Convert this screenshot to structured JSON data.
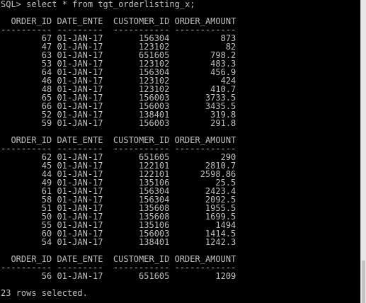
{
  "prompt": "SQL> select * from tgt_orderlisting_x;",
  "headers": [
    "ORDER_ID",
    "DATE_ENTE",
    "CUSTOMER_ID",
    "ORDER_AMOUNT"
  ],
  "separators": [
    "----------",
    "---------",
    "-----------",
    "------------"
  ],
  "pages": [
    {
      "rows": [
        [
          "67",
          "01-JAN-17",
          "156304",
          "873"
        ],
        [
          "47",
          "01-JAN-17",
          "123102",
          "82"
        ],
        [
          "63",
          "01-JAN-17",
          "651605",
          "798.2"
        ],
        [
          "53",
          "01-JAN-17",
          "123102",
          "483.3"
        ],
        [
          "64",
          "01-JAN-17",
          "156304",
          "456.9"
        ],
        [
          "46",
          "01-JAN-17",
          "123102",
          "424"
        ],
        [
          "48",
          "01-JAN-17",
          "123102",
          "410.7"
        ],
        [
          "65",
          "01-JAN-17",
          "156003",
          "3733.5"
        ],
        [
          "66",
          "01-JAN-17",
          "156003",
          "3435.5"
        ],
        [
          "52",
          "01-JAN-17",
          "138401",
          "319.8"
        ],
        [
          "59",
          "01-JAN-17",
          "156003",
          "291.8"
        ]
      ]
    },
    {
      "rows": [
        [
          "62",
          "01-JAN-17",
          "651605",
          "290"
        ],
        [
          "45",
          "01-JAN-17",
          "122101",
          "2810.7"
        ],
        [
          "44",
          "01-JAN-17",
          "122101",
          "2598.86"
        ],
        [
          "49",
          "01-JAN-17",
          "135106",
          "25.5"
        ],
        [
          "61",
          "01-JAN-17",
          "156304",
          "2423.4"
        ],
        [
          "58",
          "01-JAN-17",
          "156304",
          "2092.5"
        ],
        [
          "51",
          "01-JAN-17",
          "135608",
          "1955.5"
        ],
        [
          "50",
          "01-JAN-17",
          "135608",
          "1699.5"
        ],
        [
          "55",
          "01-JAN-17",
          "135106",
          "1494"
        ],
        [
          "60",
          "01-JAN-17",
          "156003",
          "1414.5"
        ],
        [
          "54",
          "01-JAN-17",
          "138401",
          "1242.3"
        ]
      ]
    },
    {
      "rows": [
        [
          "56",
          "01-JAN-17",
          "651605",
          "1209"
        ]
      ]
    }
  ],
  "footer": "23 rows selected.",
  "colors": {
    "background": "#000000",
    "text": "#c0c0c0"
  }
}
